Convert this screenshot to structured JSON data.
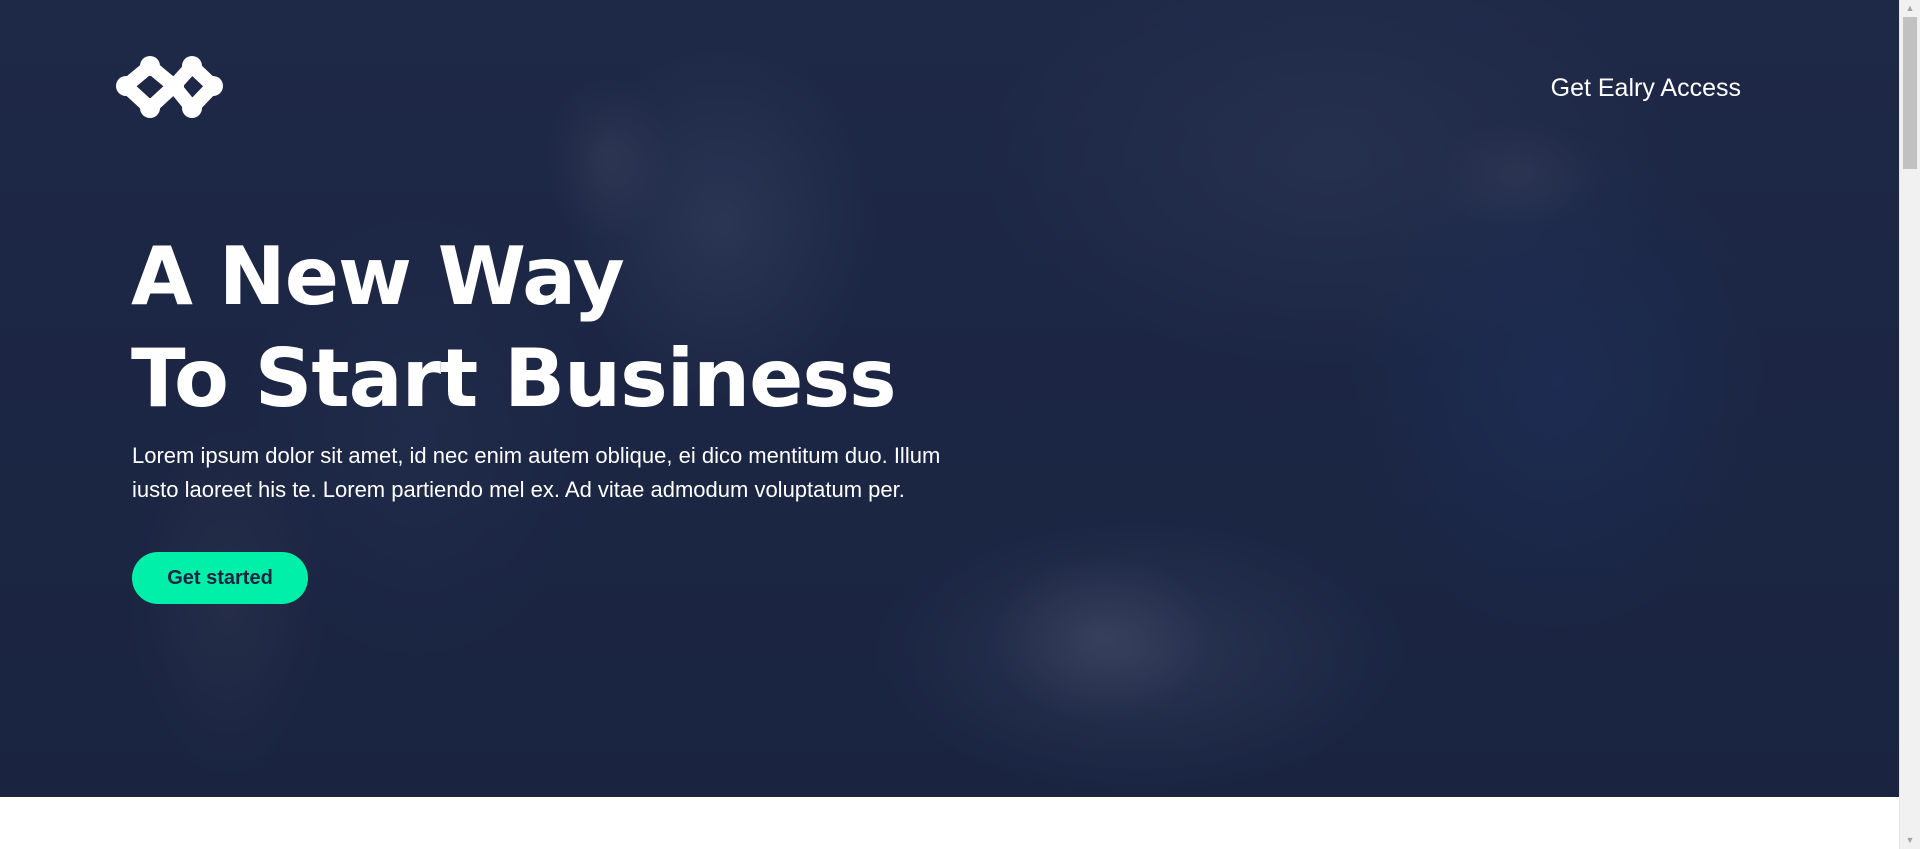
{
  "header": {
    "logo_icon": "molecule-network-logo",
    "nav_link_label": "Get Ealry Access"
  },
  "hero": {
    "headline_line_1": "A New Way",
    "headline_line_2": "To Start Business",
    "lead_text": "Lorem ipsum dolor sit amet, id nec enim autem oblique, ei dico mentitum duo. Illum iusto laoreet his te. Lorem partiendo mel ex. Ad vitae admodum voluptatum per.",
    "cta_label": "Get started",
    "background_image": "team-working-on-laptops-photo"
  },
  "scrollbar": {
    "up_icon": "scroll-up-arrow-icon",
    "down_icon": "scroll-down-arrow-icon"
  },
  "colors": {
    "overlay": "#172242",
    "accent": "#00f0a9",
    "button_text": "#1c2240",
    "text": "#ffffff"
  }
}
